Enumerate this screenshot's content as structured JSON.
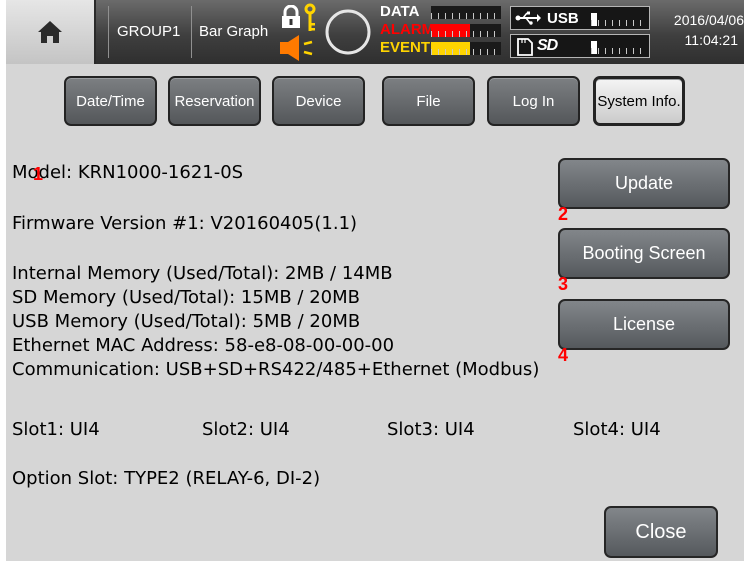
{
  "statusbar": {
    "group_label": "GROUP1",
    "view_label": "Bar Graph",
    "data_label": "DATA",
    "alarm_label": "ALARM",
    "event_label": "EVENT",
    "usb_label": "USB",
    "date": "2016/04/06",
    "time": "11:04:21",
    "data_level": 0.0,
    "alarm_level": 0.55,
    "event_level": 0.55,
    "usb_level": 0.1,
    "sd_level": 0.1,
    "colors": {
      "data": "#ffffff",
      "alarm": "#ff0000",
      "event": "#ffd400",
      "usb": "#ffffff"
    }
  },
  "tabs": [
    {
      "label": "Date/Time"
    },
    {
      "label": "Reservation"
    },
    {
      "label": "Device"
    },
    {
      "label": "File"
    },
    {
      "label": "Log In"
    },
    {
      "label": "System Info."
    }
  ],
  "info": {
    "model": "Model: KRN1000-1621-0S",
    "firmware": "Firmware Version #1: V20160405(1.1)",
    "internal_memory": "Internal Memory (Used/Total): 2MB / 14MB",
    "sd_memory": "SD Memory (Used/Total): 15MB / 20MB",
    "usb_memory": "USB Memory (Used/Total): 5MB / 20MB",
    "mac": "Ethernet MAC Address: 58-e8-08-00-00-00",
    "communication": "Communication: USB+SD+RS422/485+Ethernet (Modbus)",
    "slots": [
      "Slot1: UI4",
      "Slot2: UI4",
      "Slot3: UI4",
      "Slot4: UI4"
    ],
    "option_slot": "Option Slot: TYPE2 (RELAY-6, DI-2)"
  },
  "buttons": {
    "update": "Update",
    "booting_screen": "Booting Screen",
    "license": "License",
    "close": "Close"
  },
  "markers": [
    "1",
    "2",
    "3",
    "4"
  ]
}
